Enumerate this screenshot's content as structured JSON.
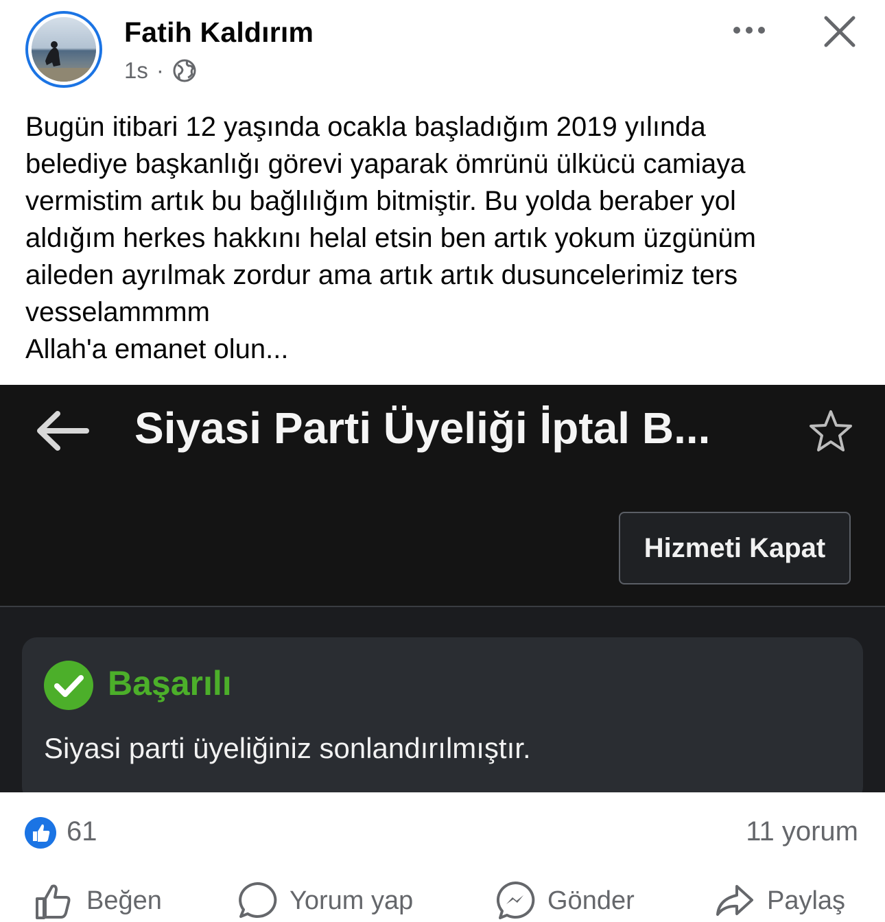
{
  "post": {
    "author": "Fatih Kaldırım",
    "time": "1s",
    "separator": "·",
    "text": "Bugün itibari 12 yaşında ocakla başladığım 2019 yılında\nbelediye başkanlığı görevi yaparak ömrünü ülkücü camiaya\nvermistim artık bu bağlılığım bitmiştir. Bu yolda beraber yol\naldığım herkes hakkını helal etsin ben artık yokum üzgünüm\naileden ayrılmak zordur ama artık artık dusuncelerimiz ters\nvesselammmm\nAllah'a emanet olun..."
  },
  "attachment": {
    "title": "Siyasi Parti Üyeliği İptal B...",
    "button_label": "Hizmeti Kapat",
    "status_label": "Başarılı",
    "message": "Siyasi parti üyeliğiniz sonlandırılmıştır.",
    "colors": {
      "success": "#4caf2a",
      "background": "#141414"
    }
  },
  "reactions": {
    "like_count": "61",
    "comment_count": "11 yorum"
  },
  "actions": {
    "like_label": "Beğen",
    "comment_label": "Yorum yap",
    "send_label": "Gönder",
    "share_label": "Paylaş"
  },
  "colors": {
    "accent": "#1b74e4",
    "secondary_text": "#65676b"
  },
  "icons": [
    "globe-icon",
    "more-options-icon",
    "close-icon",
    "back-arrow-icon",
    "star-icon",
    "check-circle-icon",
    "thumbs-up-icon",
    "comment-icon",
    "messenger-icon",
    "share-icon"
  ]
}
